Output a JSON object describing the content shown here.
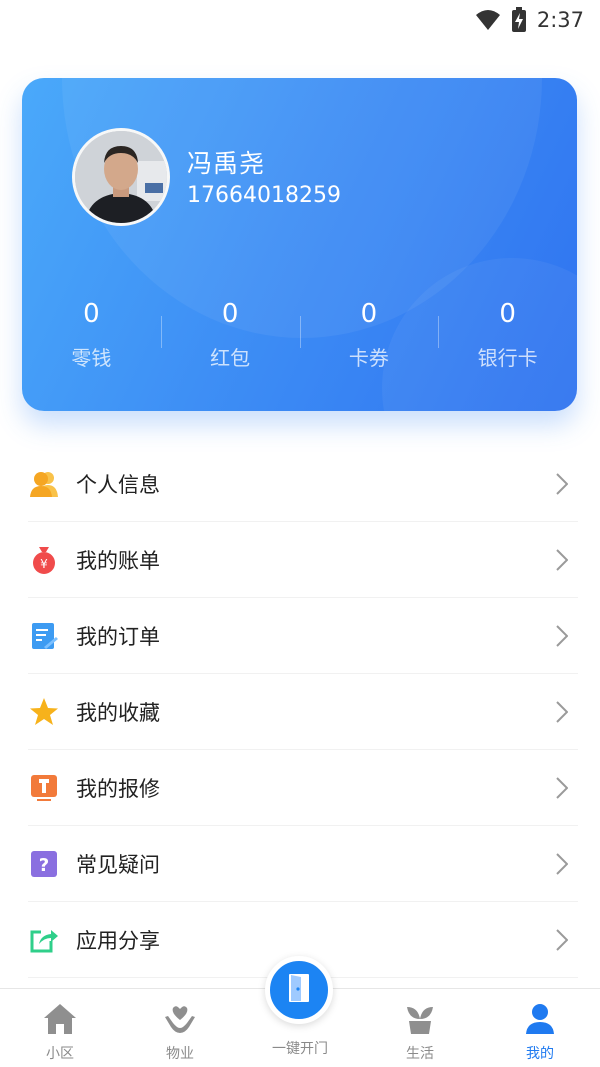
{
  "status_bar": {
    "time": "2:37"
  },
  "profile": {
    "name": "冯禹尧",
    "phone": "17664018259",
    "stats": [
      {
        "value": "0",
        "label": "零钱"
      },
      {
        "value": "0",
        "label": "红包"
      },
      {
        "value": "0",
        "label": "卡券"
      },
      {
        "value": "0",
        "label": "银行卡"
      }
    ]
  },
  "menu": {
    "items": [
      {
        "label": "个人信息",
        "icon": "person-icon",
        "color": "#f5a623"
      },
      {
        "label": "我的账单",
        "icon": "money-bag-icon",
        "color": "#f04b4b"
      },
      {
        "label": "我的订单",
        "icon": "order-icon",
        "color": "#3d9bf2"
      },
      {
        "label": "我的收藏",
        "icon": "star-icon",
        "color": "#f7b21b"
      },
      {
        "label": "我的报修",
        "icon": "repair-icon",
        "color": "#f27a3a"
      },
      {
        "label": "常见疑问",
        "icon": "question-icon",
        "color": "#8a6fe0"
      },
      {
        "label": "应用分享",
        "icon": "share-icon",
        "color": "#2fcf8a"
      }
    ]
  },
  "tabbar": {
    "tabs": [
      {
        "label": "小区",
        "icon": "home-icon"
      },
      {
        "label": "物业",
        "icon": "heart-hand-icon"
      },
      {
        "label": "一键开门",
        "icon": "door-icon"
      },
      {
        "label": "生活",
        "icon": "plant-icon"
      },
      {
        "label": "我的",
        "icon": "user-icon",
        "active": true
      }
    ]
  },
  "colors": {
    "accent": "#1f7af0",
    "card_start": "#4aa9fa",
    "card_end": "#2f73f0"
  }
}
